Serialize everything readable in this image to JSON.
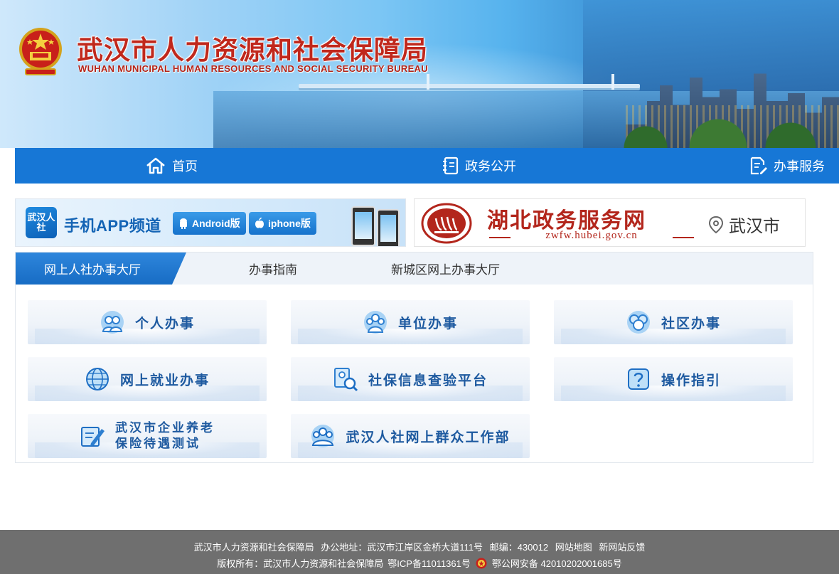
{
  "header": {
    "title": "武汉市人力资源和社会保障局",
    "subtitle": "WUHAN MUNICIPAL HUMAN RESOURCES AND SOCIAL SECURITY BUREAU"
  },
  "nav": {
    "items": [
      {
        "label": "首页",
        "icon": "home-icon"
      },
      {
        "label": "政务公开",
        "icon": "notebook-icon"
      },
      {
        "label": "办事服务",
        "icon": "document-edit-icon"
      }
    ]
  },
  "promo_app": {
    "badge": "武汉人社",
    "title": "手机APP频道",
    "android_label": "Android版",
    "iphone_label": "iphone版"
  },
  "promo_zwfw": {
    "title": "湖北政务服务网",
    "url": "zwfw.hubei.gov.cn",
    "city": "武汉市"
  },
  "tabs": [
    {
      "label": "网上人社办事大厅",
      "active": true
    },
    {
      "label": "办事指南",
      "active": false
    },
    {
      "label": "新城区网上办事大厅",
      "active": false
    }
  ],
  "services": [
    {
      "label": "个人办事",
      "icon": "people-icon"
    },
    {
      "label": "单位办事",
      "icon": "group-icon"
    },
    {
      "label": "社区办事",
      "icon": "community-icon"
    },
    {
      "label": "网上就业办事",
      "icon": "globe-icon"
    },
    {
      "label": "社保信息查验平台",
      "icon": "magnifier-user-icon"
    },
    {
      "label": "操作指引",
      "icon": "help-icon"
    },
    {
      "label_line1": "武汉市企业养老",
      "label_line2": "保险待遇测试",
      "icon": "edit-form-icon"
    },
    {
      "label": "武汉人社网上群众工作部",
      "icon": "crowd-icon"
    }
  ],
  "footer": {
    "org": "武汉市人力资源和社会保障局",
    "address": "办公地址：武汉市江岸区金桥大道111号",
    "postcode": "邮编：430012",
    "sitemap": "网站地图",
    "feedback": "新网站反馈",
    "copyright": "版权所有：武汉市人力资源和社会保障局",
    "icp": "鄂ICP备11011361号",
    "police": "鄂公网安备 42010202001685号"
  },
  "colors": {
    "nav_blue": "#1777d6",
    "title_red": "#c0281c",
    "service_text": "#1e5aa0",
    "footer_gray": "#6f6f6f"
  }
}
